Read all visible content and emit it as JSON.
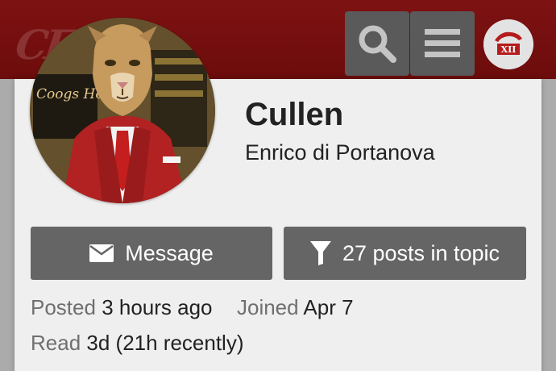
{
  "header": {
    "logo_text": "CF",
    "search_icon": "search-icon",
    "menu_icon": "hamburger-menu-icon",
    "user_avatar_text": "XII"
  },
  "profile": {
    "username": "Cullen",
    "full_name": "Enrico di Portanova",
    "avatar_sign_text": "Coogs House"
  },
  "actions": {
    "message_label": "Message",
    "message_icon": "envelope-icon",
    "posts_label": "27 posts in topic",
    "posts_icon": "filter-icon"
  },
  "meta": {
    "posted_label": "Posted",
    "posted_value": "3 hours ago",
    "joined_label": "Joined",
    "joined_value": "Apr 7",
    "read_label": "Read",
    "read_value": "3d (21h recently)"
  },
  "colors": {
    "header_bg": "#7a1111",
    "button_bg": "#656565",
    "card_bg": "#efefef",
    "header_button_bg": "#5a5a5a"
  }
}
